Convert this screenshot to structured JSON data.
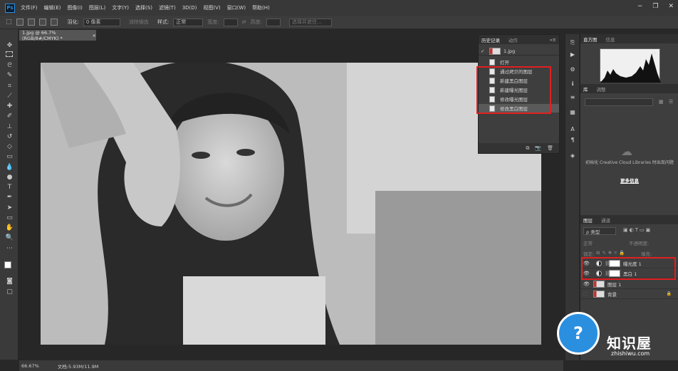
{
  "app": {
    "logo": "Ps"
  },
  "menu": [
    "文件(F)",
    "编辑(E)",
    "图像(I)",
    "图层(L)",
    "文字(Y)",
    "选择(S)",
    "滤镜(T)",
    "3D(D)",
    "视图(V)",
    "窗口(W)",
    "帮助(H)"
  ],
  "window_controls": [
    "−",
    "❐",
    "✕"
  ],
  "options": {
    "feather_label": "羽化:",
    "feather_value": "0 像素",
    "antialias": "消除锯齿",
    "style_label": "样式:",
    "style_value": "正常",
    "width_label": "宽度:",
    "height_label": "高度:",
    "select_mask": "选择并遮住..."
  },
  "document": {
    "tab_title": "1.jpg @ 66.7%(RGB/8#/CMYK) *",
    "close": "×"
  },
  "status": {
    "zoom": "66.67%",
    "doc_info": "文档:5.93M/11.9M"
  },
  "history": {
    "tabs": [
      "历史记录",
      "动作"
    ],
    "snapshot": "1.jpg",
    "steps": [
      "打开",
      "通过拷贝的图层",
      "新建黑白图层",
      "新建曝光图层",
      "修改曝光图层",
      "修改黑白图层"
    ],
    "selected_index": 5
  },
  "histogram": {
    "tabs": [
      "直方图",
      "信息"
    ],
    "warning": "⚠"
  },
  "libraries": {
    "tabs": [
      "库",
      "调整"
    ],
    "message": "初始化 Creative Cloud Libraries 时出现问题",
    "more_info": "更多信息"
  },
  "layers": {
    "tabs": [
      "图层",
      "通道"
    ],
    "filter_label": "ρ 类型",
    "blend_mode": "正常",
    "opacity_label": "不透明度:",
    "lock_label": "锁定:",
    "fill_label": "填充:",
    "items": [
      {
        "name": "曝光度 1",
        "type": "adjustment"
      },
      {
        "name": "黑白 1",
        "type": "adjustment"
      },
      {
        "name": "图层 1",
        "type": "pixel"
      },
      {
        "name": "背景",
        "type": "background"
      }
    ],
    "lock_icon": "🔒"
  },
  "watermark": {
    "title": "知识屋",
    "url": "zhishiwu.com",
    "glyph": "?"
  }
}
